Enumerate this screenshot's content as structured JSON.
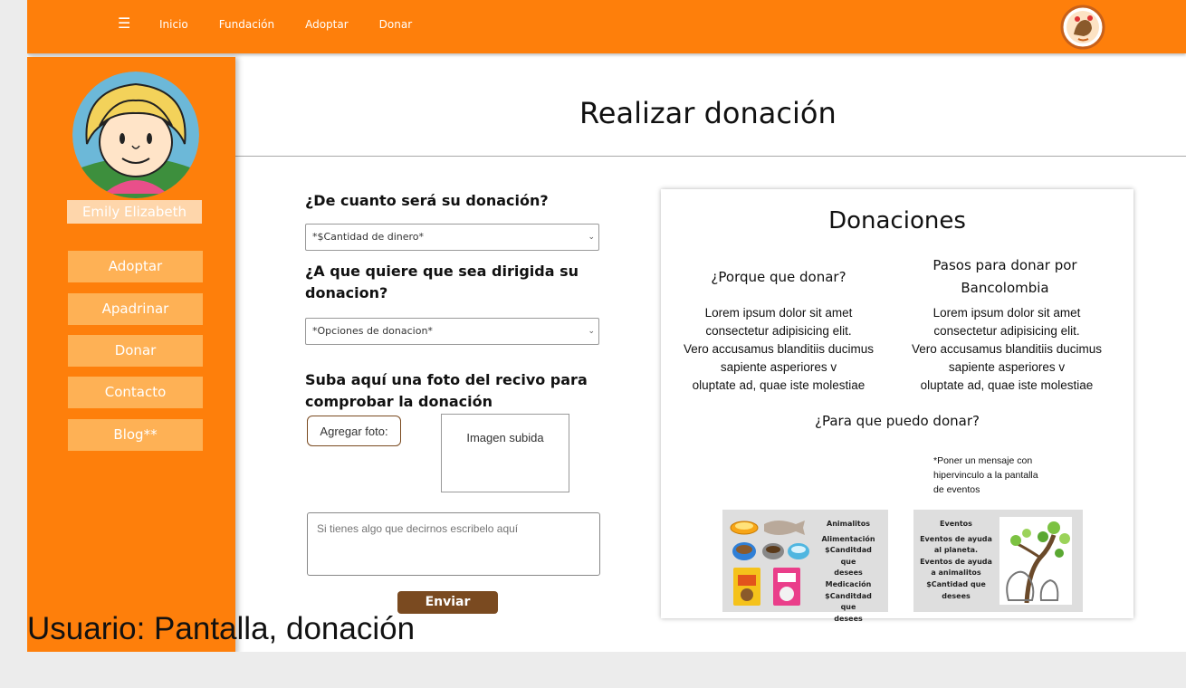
{
  "nav": {
    "menu_icon": "☰",
    "links": [
      "Inicio",
      "Fundación",
      "Adoptar",
      "Donar"
    ],
    "logo": "paw-logo-icon"
  },
  "sidebar": {
    "username": "Emily Elizabeth",
    "items": [
      "Adoptar",
      "Apadrinar",
      "Donar",
      "Contacto",
      "Blog**"
    ]
  },
  "main": {
    "title": "Realizar donación",
    "form": {
      "q_amount": "¿De cuanto será su donación?",
      "amount_placeholder": "*$Cantidad de dinero*",
      "q_target": "¿A que quiere que sea dirigida su donacion?",
      "target_placeholder": "*Opciones de donacion*",
      "q_photo": "Suba aquí una foto del recivo para comprobar la donación",
      "add_photo": "Agregar foto:",
      "image_box": "Imagen subida",
      "message_placeholder": "Si tienes algo que decirnos escribelo aquí",
      "send": "Enviar"
    },
    "info": {
      "title": "Donaciones",
      "why_title": "¿Porque que donar?",
      "why_text": [
        "Lorem ipsum dolor sit amet",
        "consectetur adipisicing elit.",
        "Vero accusamus blanditiis ducimus",
        "sapiente asperiores v",
        "oluptate ad, quae iste molestiae"
      ],
      "steps_title_1": "Pasos para donar por",
      "steps_title_2": "Bancolombia",
      "steps_text": [
        "Lorem ipsum dolor sit amet",
        "consectetur adipisicing elit.",
        "Vero accusamus blanditiis ducimus",
        "sapiente asperiores v",
        "oluptate ad, quae iste molestiae"
      ],
      "for_title": "¿Para que puedo donar?",
      "note": [
        "*Poner un mensaje con",
        "hipervinculo a la pantalla",
        "de eventos"
      ],
      "promo_animals": [
        "Animalitos",
        "Alimentación",
        "$Canditdad que",
        "desees",
        "Medicación",
        "$Canditdad que",
        "desees"
      ],
      "promo_events": [
        "Eventos",
        "Eventos de ayuda",
        "al planeta.",
        "Eventos de ayuda",
        "a animalitos",
        "$Cantidad que",
        "desees"
      ]
    }
  },
  "caption": "Usuario: Pantalla, donación",
  "colors": {
    "orange": "#fe7f0b",
    "button": "#feb155",
    "brown": "#7a4a20"
  }
}
